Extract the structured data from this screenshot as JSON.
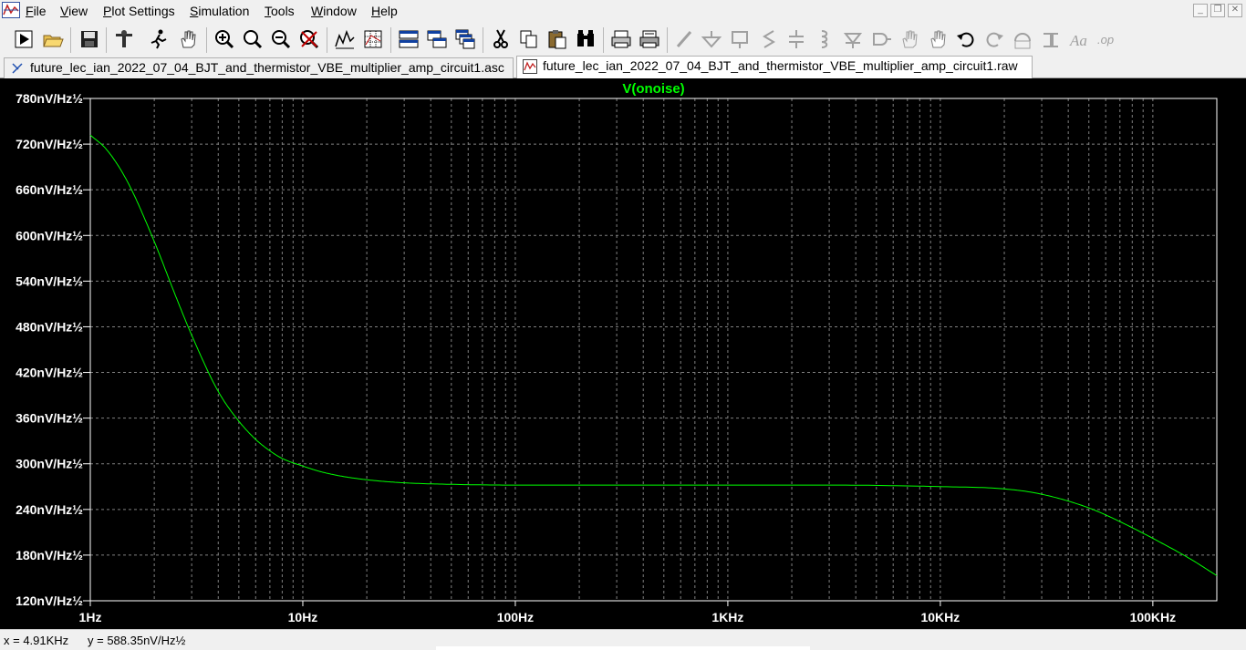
{
  "menu": [
    "File",
    "View",
    "Plot Settings",
    "Simulation",
    "Tools",
    "Window",
    "Help"
  ],
  "window_controls": {
    "minimize": "_",
    "restore": "❐",
    "close": "✕"
  },
  "toolbar_icons": [
    "run-icon",
    "open-icon",
    "save-icon",
    "control-panel-icon",
    "run-sim-icon",
    "pan-icon",
    "zoom-in-icon",
    "zoom-area-icon",
    "zoom-out-icon",
    "zoom-cancel-icon",
    "autorange-icon",
    "grid-icon",
    "tile-horizontal-icon",
    "tile-vertical-icon",
    "cascade-icon",
    "cut-icon",
    "copy-icon",
    "paste-icon",
    "find-icon",
    "print-preview-icon",
    "print-icon",
    "wire-icon",
    "ground-icon",
    "label-icon",
    "resistor-icon",
    "capacitor-icon",
    "inductor-icon",
    "diode-icon",
    "component-icon",
    "move-icon",
    "drag-icon",
    "undo-icon",
    "redo-icon",
    "rotate-icon",
    "mirror-icon",
    "text-icon",
    "spice-directive-icon"
  ],
  "tabs": [
    {
      "label": "future_lec_ian_2022_07_04_BJT_and_thermistor_VBE_multiplier_amp_circuit1.asc",
      "icon": "schematic-icon",
      "active": false
    },
    {
      "label": "future_lec_ian_2022_07_04_BJT_and_thermistor_VBE_multiplier_amp_circuit1.raw",
      "icon": "waveform-icon",
      "active": true
    }
  ],
  "chart_data": {
    "type": "line",
    "title": "V(onoise)",
    "x_scale": "log",
    "xlim": [
      1,
      200000
    ],
    "ylim": [
      120,
      780
    ],
    "x_ticks": [
      {
        "value": 1,
        "label": "1Hz"
      },
      {
        "value": 10,
        "label": "10Hz"
      },
      {
        "value": 100,
        "label": "100Hz"
      },
      {
        "value": 1000,
        "label": "1KHz"
      },
      {
        "value": 10000,
        "label": "10KHz"
      },
      {
        "value": 100000,
        "label": "100KHz"
      }
    ],
    "y_ticks": [
      {
        "value": 780,
        "label": "780nV/Hz½"
      },
      {
        "value": 720,
        "label": "720nV/Hz½"
      },
      {
        "value": 660,
        "label": "660nV/Hz½"
      },
      {
        "value": 600,
        "label": "600nV/Hz½"
      },
      {
        "value": 540,
        "label": "540nV/Hz½"
      },
      {
        "value": 480,
        "label": "480nV/Hz½"
      },
      {
        "value": 420,
        "label": "420nV/Hz½"
      },
      {
        "value": 360,
        "label": "360nV/Hz½"
      },
      {
        "value": 300,
        "label": "300nV/Hz½"
      },
      {
        "value": 240,
        "label": "240nV/Hz½"
      },
      {
        "value": 180,
        "label": "180nV/Hz½"
      },
      {
        "value": 120,
        "label": "120nV/Hz½"
      }
    ],
    "grid": true,
    "colors": {
      "background": "#000000",
      "trace": "#00ff00",
      "grid": "#808080",
      "axis": "#ffffff",
      "title": "#00ff00"
    },
    "series": [
      {
        "name": "V(onoise)",
        "x": [
          1,
          1.2,
          1.5,
          2,
          2.5,
          3,
          4,
          5,
          6,
          7,
          8,
          10,
          12,
          15,
          20,
          30,
          50,
          100,
          300,
          1000,
          3000,
          10000,
          20000,
          30000,
          50000,
          70000,
          100000,
          150000,
          200000
        ],
        "y": [
          732,
          712,
          670,
          592,
          523,
          469,
          395,
          356,
          332,
          317,
          307,
          297,
          290,
          284,
          279,
          275,
          273,
          272,
          272,
          272,
          272,
          270,
          267,
          260,
          242,
          224,
          202,
          175,
          153
        ]
      }
    ]
  },
  "status": {
    "x": "x = 4.91KHz",
    "y": "y = 588.35nV/Hz½"
  }
}
